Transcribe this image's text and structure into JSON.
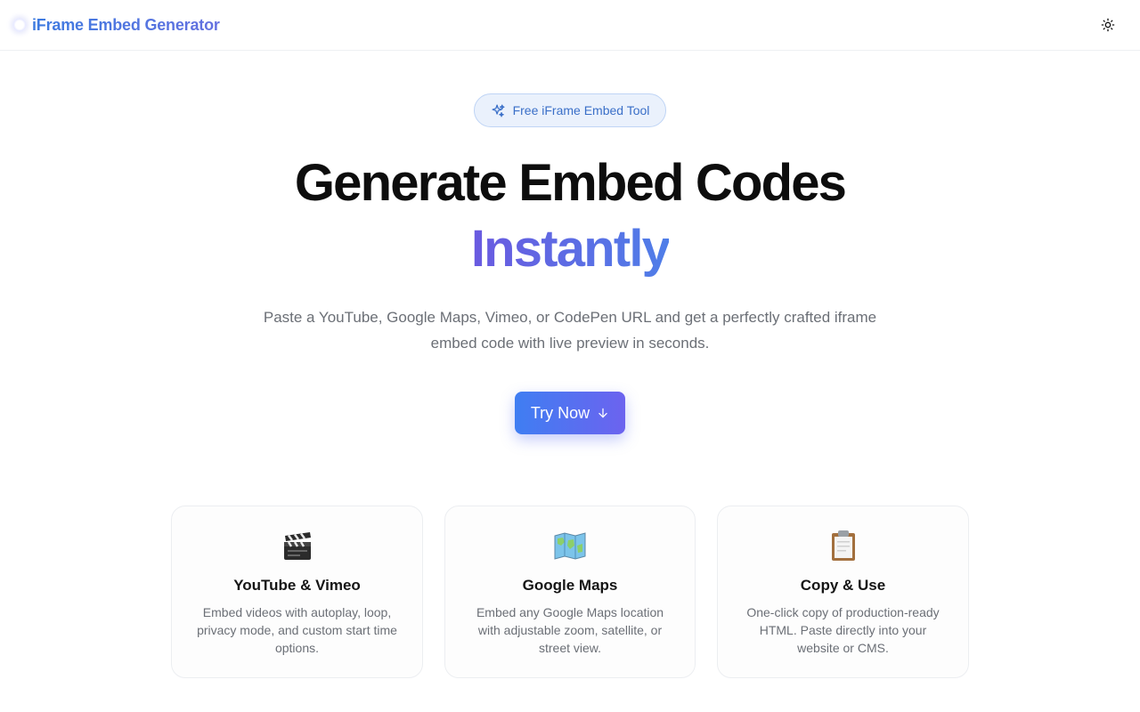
{
  "header": {
    "brand_title": "iFrame Embed Generator",
    "theme_toggle_icon": "sun-icon"
  },
  "hero": {
    "badge_icon": "sparkles-icon",
    "badge_label": "Free iFrame Embed Tool",
    "title": "Generate Embed Codes",
    "title_accent": "Instantly",
    "subtitle": "Paste a YouTube, Google Maps, Vimeo, or CodePen URL and get a perfectly crafted iframe embed code with live preview in seconds.",
    "cta_label": "Try Now",
    "cta_icon": "arrow-down-icon"
  },
  "features": [
    {
      "icon": "clapperboard-icon",
      "title": "YouTube & Vimeo",
      "text": "Embed videos with autoplay, loop, privacy mode, and custom start time options."
    },
    {
      "icon": "map-icon",
      "title": "Google Maps",
      "text": "Embed any Google Maps location with adjustable zoom, satellite, or street view."
    },
    {
      "icon": "clipboard-icon",
      "title": "Copy & Use",
      "text": "One-click copy of production-ready HTML. Paste directly into your website or CMS."
    }
  ],
  "colors": {
    "brand_gradient_start": "#3f7ef2",
    "brand_gradient_end": "#6c63ef",
    "badge_background": "#eaf1fc",
    "muted_text": "#6b6f76"
  }
}
